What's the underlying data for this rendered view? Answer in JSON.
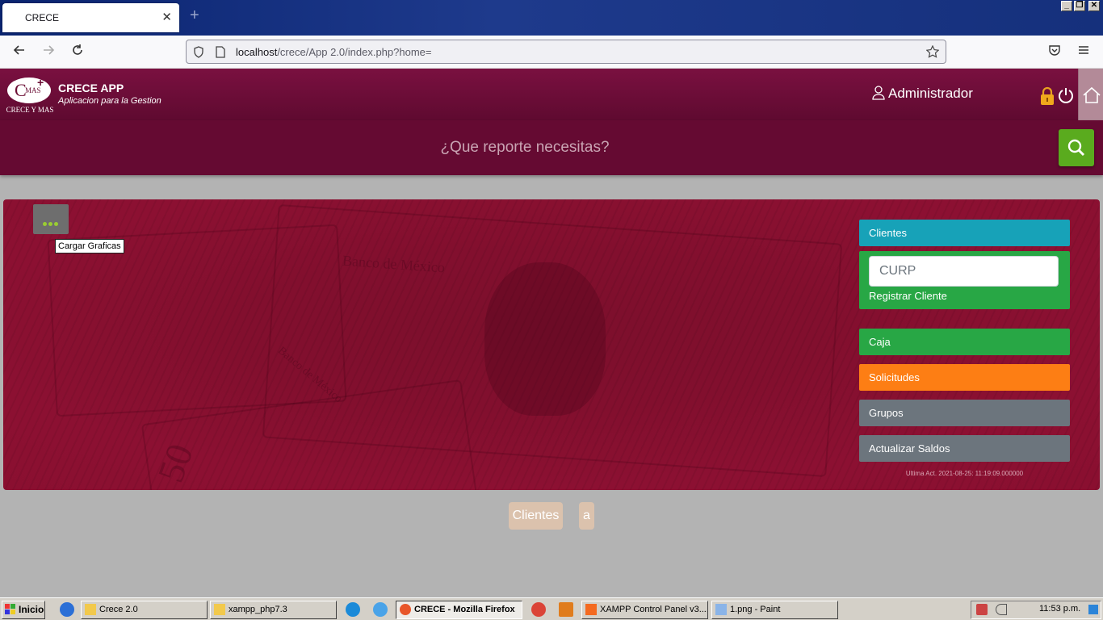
{
  "browser": {
    "tab_title": "CRECE",
    "tab_close": "✕",
    "new_tab": "+",
    "url_host": "localhost",
    "url_path": "/crece/App 2.0/index.php?home="
  },
  "app": {
    "logo_text": "CRECE Y MAS",
    "logo_mark": "C",
    "logo_mas": "MAS",
    "logo_plus": "+",
    "title": "CRECE APP",
    "subtitle": "Aplicacion para la Gestion",
    "user_name": "Administrador"
  },
  "search": {
    "placeholder": "¿Que reporte necesitas?"
  },
  "banner": {
    "tooltip": "Cargar Graficas",
    "bill_caption": "Banco de México",
    "bill_caption_2": "Banco de México",
    "bill_number": "50",
    "menu": {
      "clientes": "Clientes",
      "curp_placeholder": "CURP",
      "registrar": "Registrar Cliente",
      "caja": "Caja",
      "solicitudes": "Solicitudes",
      "grupos": "Grupos",
      "actualizar": "Actualizar Saldos"
    },
    "last_update": "Ultima Act. 2021-08-25: 11:19:09.000000"
  },
  "pills": {
    "clientes": "Clientes",
    "a": "a"
  },
  "taskbar": {
    "start": "Inicio",
    "items": [
      "Crece 2.0",
      "xampp_php7.3",
      "CRECE - Mozilla Firefox",
      "XAMPP Control Panel v3....",
      "1.png - Paint"
    ],
    "clock": "11:53 p.m."
  },
  "colors": {
    "header": "#5f0a30",
    "accent_green": "#28a745",
    "accent_cyan": "#17a2b8",
    "accent_orange": "#fd7e14",
    "accent_gray": "#6c757d",
    "search_button": "#5aab1e"
  }
}
